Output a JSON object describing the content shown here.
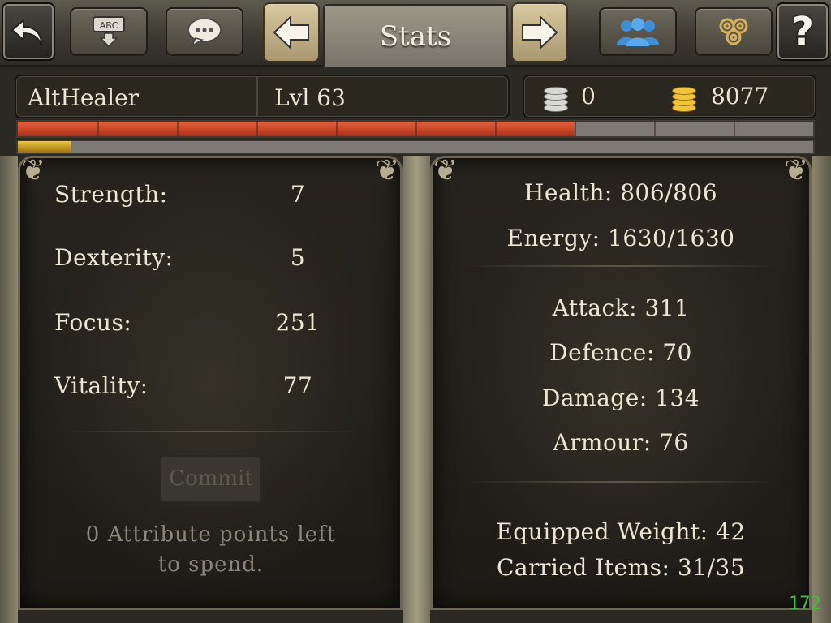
{
  "toolbar": {
    "title": "Stats",
    "icons": [
      "back-icon",
      "keyboard-icon",
      "chat-icon",
      "arrow-left-icon",
      "arrow-right-icon",
      "party-icon",
      "triskelion-icon",
      "help-icon"
    ],
    "keyboard_label": "ABC",
    "help_label": "?"
  },
  "character": {
    "name": "AltHealer",
    "level": "Lvl 63"
  },
  "currency": {
    "silver": "0",
    "gold": "8077"
  },
  "bars": {
    "experience_fraction": 0.7,
    "secondary_fraction": 0.066,
    "colors": {
      "experience": "#c2401f",
      "secondary": "#e0a820"
    }
  },
  "attributes": [
    {
      "label": "Strength:",
      "value": "7"
    },
    {
      "label": "Dexterity:",
      "value": "5"
    },
    {
      "label": "Focus:",
      "value": "251"
    },
    {
      "label": "Vitality:",
      "value": "77"
    }
  ],
  "commit_label": "Commit",
  "points_left_line1": "0 Attribute points left",
  "points_left_line2": "to spend.",
  "vitals": {
    "health": "Health: 806/806",
    "energy": "Energy: 1630/1630"
  },
  "combat": {
    "attack": "Attack: 311",
    "defence": "Defence: 70",
    "damage": "Damage: 134",
    "armour": "Armour: 76"
  },
  "inventory": {
    "equipped_weight": "Equipped Weight: 42",
    "carried_items": "Carried Items: 31/35"
  },
  "fps_counter": "172"
}
